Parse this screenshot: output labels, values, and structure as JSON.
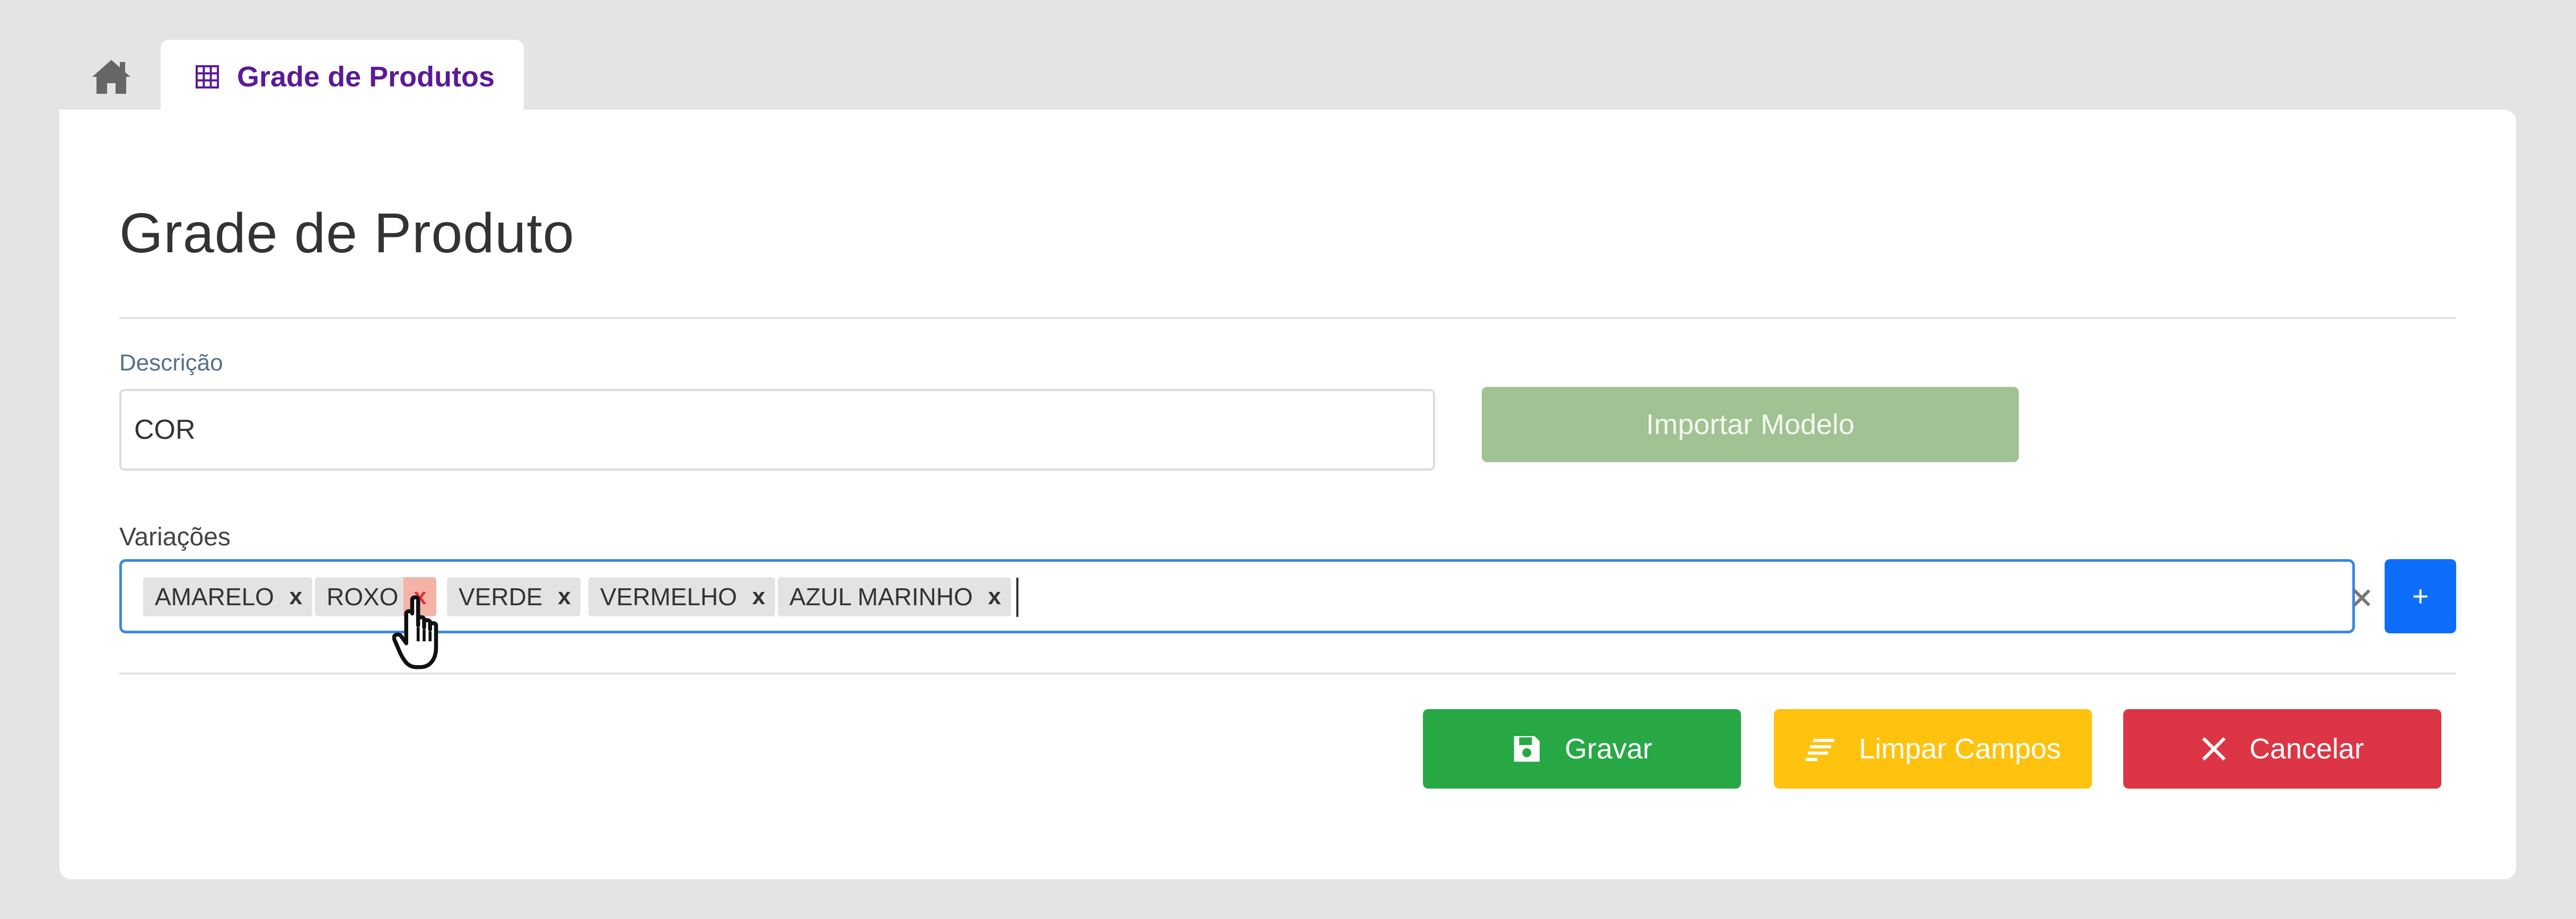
{
  "tabs": {
    "home_icon": "home-icon",
    "active": {
      "label": "Grade de Produtos",
      "icon": "grid-icon",
      "color": "#5b1a98"
    }
  },
  "page": {
    "title": "Grade de Produto"
  },
  "form": {
    "descricao": {
      "label": "Descrição",
      "value": "COR"
    },
    "import_button": {
      "label": "Importar Modelo",
      "color": "#a1c293"
    },
    "variacoes": {
      "label": "Variações",
      "chips": [
        "AMARELO",
        "ROXO",
        "VERDE",
        "VERMELHO",
        "AZUL MARINHO"
      ],
      "hovered_remove_chip": "ROXO",
      "focus_color": "#3a88e3"
    },
    "add_button": {
      "label": "+",
      "color": "#0d6efd"
    }
  },
  "actions": {
    "save": {
      "label": "Gravar",
      "icon": "floppy-disk-icon",
      "color": "#28a845"
    },
    "clear": {
      "label": "Limpar Campos",
      "icon": "clear-lines-icon",
      "color": "#ffc20e"
    },
    "cancel": {
      "label": "Cancelar",
      "icon": "close-icon",
      "color": "#dc3545"
    }
  },
  "chip_remove_glyph": "x"
}
